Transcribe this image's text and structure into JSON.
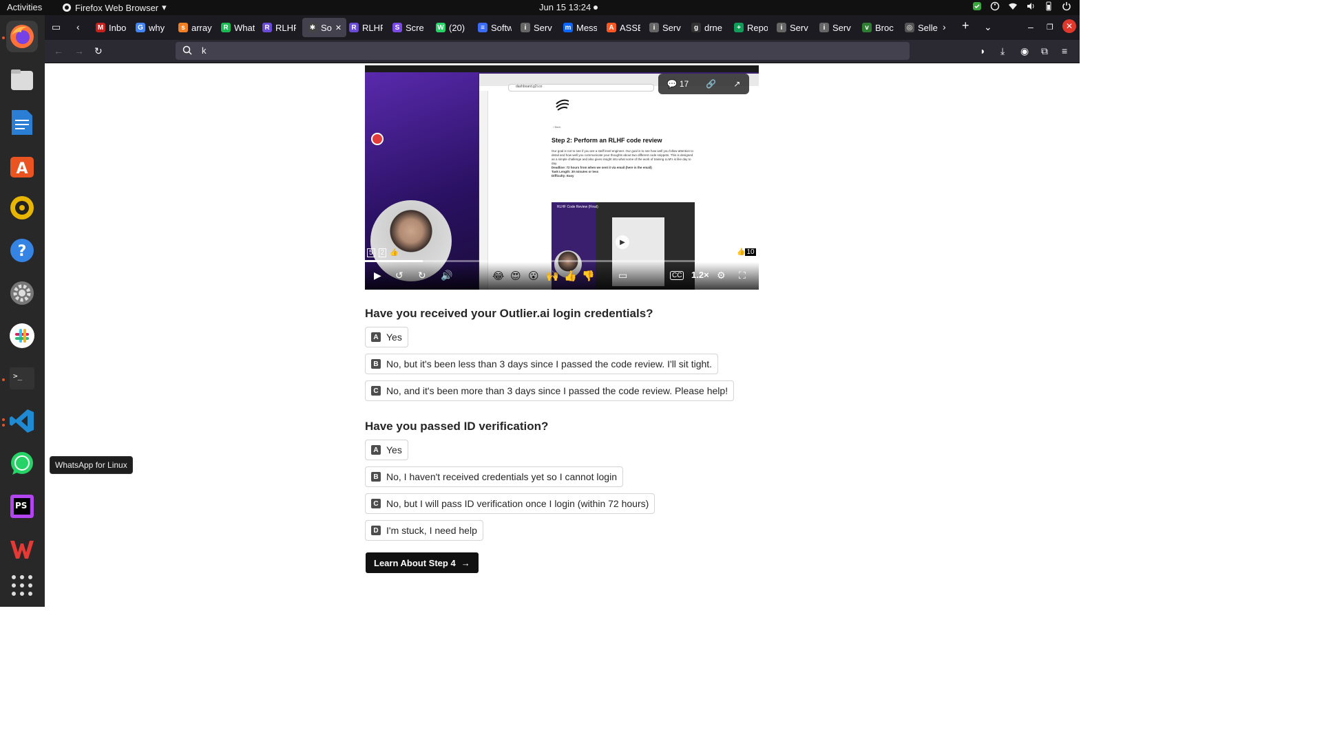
{
  "topbar": {
    "activities": "Activities",
    "app_menu": "Firefox Web Browser",
    "clock": "Jun 15  13:24"
  },
  "dock": {
    "apps": [
      "firefox",
      "files",
      "libreoffice-writer",
      "app-center",
      "rhythmbox",
      "help",
      "settings",
      "slack",
      "terminal",
      "vscode",
      "whatsapp",
      "phpstorm",
      "wps-office",
      "show-apps"
    ],
    "tooltip": "WhatsApp for Linux"
  },
  "browser": {
    "tabs": [
      {
        "label": "Inbo",
        "color": "#c5221f",
        "glyph": "M"
      },
      {
        "label": "why",
        "color": "#4285f4",
        "glyph": "G"
      },
      {
        "label": "array",
        "color": "#f48024",
        "glyph": "s"
      },
      {
        "label": "What",
        "color": "#1db954",
        "glyph": "R"
      },
      {
        "label": "RLHF",
        "color": "#6a4bd8",
        "glyph": "R"
      },
      {
        "label": "So",
        "color": "#444",
        "glyph": "✱",
        "active": true
      },
      {
        "label": "RLHF",
        "color": "#6a4bd8",
        "glyph": "R"
      },
      {
        "label": "Scre",
        "color": "#7b4ae2",
        "glyph": "S"
      },
      {
        "label": "(20)",
        "color": "#25d366",
        "glyph": "W"
      },
      {
        "label": "Softw",
        "color": "#3b6cf6",
        "glyph": "≡"
      },
      {
        "label": "Serv",
        "color": "#666",
        "glyph": "i"
      },
      {
        "label": "Mess",
        "color": "#0a66ff",
        "glyph": "m"
      },
      {
        "label": "ASSE",
        "color": "#ff5722",
        "glyph": "A"
      },
      {
        "label": "Serv",
        "color": "#666",
        "glyph": "i"
      },
      {
        "label": "drne",
        "color": "#333",
        "glyph": "g"
      },
      {
        "label": "Repo",
        "color": "#0f9d58",
        "glyph": "+"
      },
      {
        "label": "Serv",
        "color": "#666",
        "glyph": "i"
      },
      {
        "label": "Serv",
        "color": "#666",
        "glyph": "i"
      },
      {
        "label": "Broc",
        "color": "#2e7d32",
        "glyph": "v"
      },
      {
        "label": "Selle",
        "color": "#555",
        "glyph": "◎"
      }
    ],
    "url": "k"
  },
  "video": {
    "comment_count": "17",
    "inner_title": "Step 2: Perform an RLHF code review",
    "inner_body": "Our goal is not to see if you are a staff level engineer. Our goal is to see how well you follow attention to detail and how well you communicate your thoughts about two different code snippets. This is designed as a simple challenge and also gives insight into what some of the work of training LLM's is like day to day.",
    "deadline": "Deadline: 72 hours from when we sent it via email (here is the email)",
    "task_length": "Task Length: 30 minutes or less",
    "difficulty": "Difficulty: Easy",
    "inner_url": "dashboard.g2i.co",
    "inner_video_label": "RLHF Code Review (Final)",
    "reaction_left_a": "5",
    "reaction_left_b": "2",
    "reaction_right": "10",
    "speed": "1.2×",
    "progress": 0.147
  },
  "q1": {
    "question": "Have you received your Outlier.ai login credentials?",
    "options": [
      {
        "key": "A",
        "text": "Yes"
      },
      {
        "key": "B",
        "text": "No, but it's been less than 3 days since I passed the code review. I'll sit tight."
      },
      {
        "key": "C",
        "text": "No, and it's been more than 3 days since I passed the code review. Please help!"
      }
    ]
  },
  "q2": {
    "question": "Have you passed ID verification?",
    "options": [
      {
        "key": "A",
        "text": "Yes"
      },
      {
        "key": "B",
        "text": "No, I haven't received credentials yet so I cannot login"
      },
      {
        "key": "C",
        "text": "No, but I will pass ID verification once I login (within 72 hours)"
      },
      {
        "key": "D",
        "text": "I'm stuck, I need help"
      }
    ]
  },
  "cta": {
    "label": "Learn About Step 4"
  }
}
